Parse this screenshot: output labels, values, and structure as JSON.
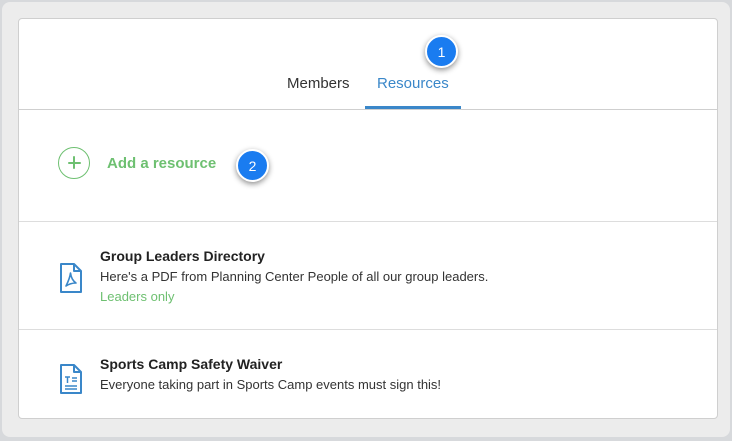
{
  "tabs": [
    {
      "label": "Members",
      "active": false
    },
    {
      "label": "Resources",
      "active": true
    }
  ],
  "add_resource": {
    "label": "Add a resource",
    "icon": "plus-circle-icon"
  },
  "resources": [
    {
      "title": "Group Leaders Directory",
      "description": "Here's a PDF from Planning Center People of all our group leaders.",
      "visibility": "Leaders only",
      "icon": "pdf-file-icon"
    },
    {
      "title": "Sports Camp Safety Waiver",
      "description": "Everyone taking part in Sports Camp events must sign this!",
      "icon": "text-file-icon"
    }
  ],
  "callouts": [
    "1",
    "2"
  ],
  "colors": {
    "accent": "#3a87c9",
    "green": "#6ec071",
    "callout": "#1a7cf0"
  }
}
